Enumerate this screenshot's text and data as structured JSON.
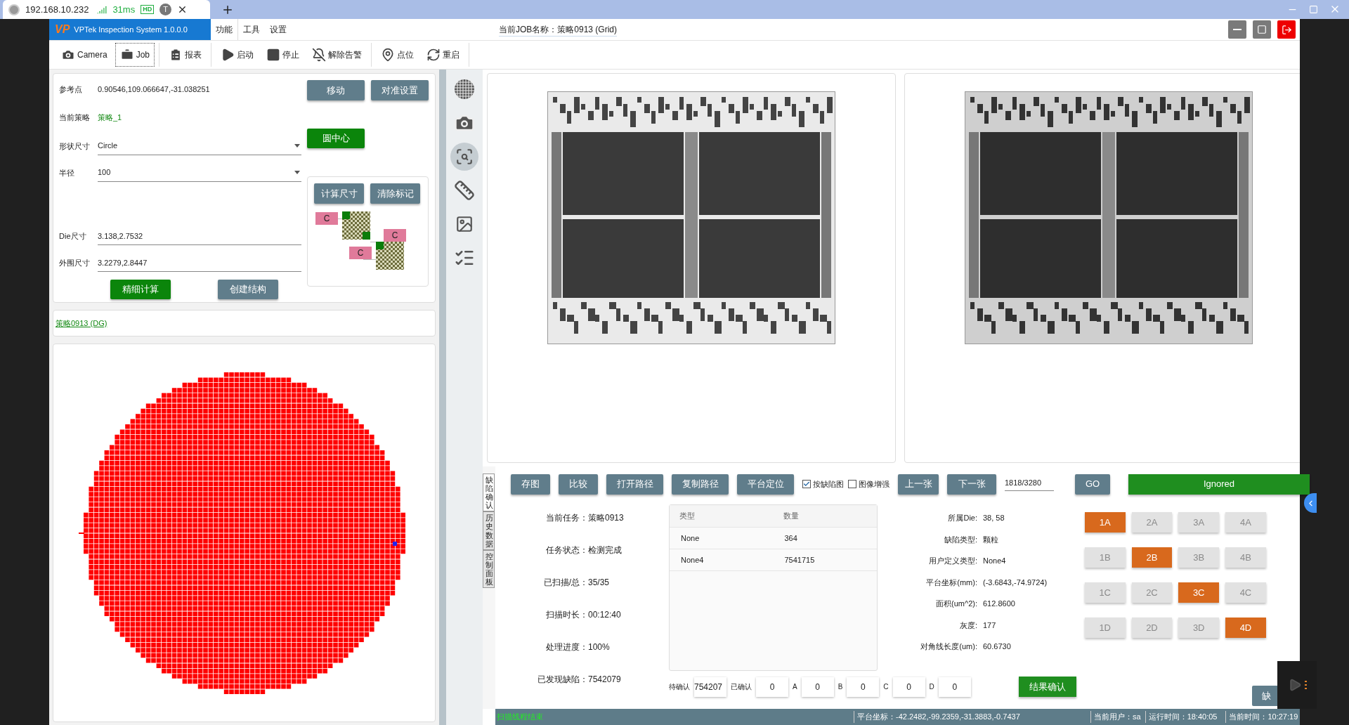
{
  "browser_tab": {
    "address": "192.168.10.232",
    "ping": "31ms",
    "badge": "HD",
    "avatar": "T"
  },
  "app": {
    "logo": "VP",
    "title": "VPTek Inspection System 1.0.0.0",
    "job_title": "当前JOB名称：策略0913 (Grid)"
  },
  "menu": [
    {
      "label": "功能",
      "selected": true
    },
    {
      "label": "工具",
      "selected": false
    },
    {
      "label": "设置",
      "selected": false
    }
  ],
  "toolbar": [
    {
      "label": "Camera",
      "kind": "camera",
      "selected": false
    },
    {
      "label": "Job",
      "kind": "job",
      "selected": true
    },
    {
      "label": "报表",
      "kind": "report",
      "selected": false
    },
    {
      "label": "启动",
      "kind": "start",
      "selected": false
    },
    {
      "label": "停止",
      "kind": "stop",
      "selected": false
    },
    {
      "label": "解除告警",
      "kind": "alarm",
      "selected": false
    },
    {
      "label": "点位",
      "kind": "point",
      "selected": false
    },
    {
      "label": "重启",
      "kind": "restart",
      "selected": false
    }
  ],
  "settings": {
    "ref_label": "参考点",
    "ref_value": "0.90546,109.066647,-31.038251",
    "strategy_label": "当前策略",
    "strategy_value": "策略_1",
    "fields": [
      {
        "label": "形状尺寸",
        "value": "Circle",
        "kind": "select"
      },
      {
        "label": "半径",
        "value": "100",
        "kind": "select"
      },
      {
        "label": "Die尺寸",
        "value": "3.138,2.7532",
        "kind": "input"
      },
      {
        "label": "外围尺寸",
        "value": "3.2279,2.8447",
        "kind": "input"
      }
    ],
    "top_buttons": [
      {
        "label": "移动",
        "kind": "slate"
      },
      {
        "label": "对准设置",
        "kind": "slate"
      }
    ],
    "center_button": {
      "label": "圆中心",
      "kind": "green"
    },
    "bottom_buttons": [
      {
        "label": "精细计算",
        "kind": "green"
      },
      {
        "label": "创建结构",
        "kind": "slate"
      }
    ],
    "structure_buttons": [
      {
        "label": "计算尺寸",
        "kind": "slate"
      },
      {
        "label": "清除标记",
        "kind": "slate"
      }
    ],
    "structure_tags": [
      "C",
      "C",
      "C"
    ]
  },
  "strategy_link": "策略0913 (DG)",
  "side_tools": [
    {
      "kind": "wafer",
      "selected": false
    },
    {
      "kind": "camera",
      "selected": false
    },
    {
      "kind": "map",
      "selected": true
    },
    {
      "kind": "tools",
      "selected": false
    },
    {
      "kind": "image",
      "selected": false
    },
    {
      "kind": "checklist",
      "selected": false
    }
  ],
  "bottom_tabs": [
    {
      "label": "缺陷确认",
      "selected": true
    },
    {
      "label": "历史数据",
      "selected": false
    },
    {
      "label": "控制面板",
      "selected": false
    }
  ],
  "actions": [
    {
      "label": "存图"
    },
    {
      "label": "比较"
    },
    {
      "label": "打开路径"
    },
    {
      "label": "复制路径"
    },
    {
      "label": "平台定位"
    }
  ],
  "checkboxes": [
    {
      "label": "按缺陷图",
      "checked": true
    },
    {
      "label": "图像增强",
      "checked": false
    }
  ],
  "nav": {
    "prev": "上一张",
    "next": "下一张",
    "page": "1818/3280",
    "go": "GO"
  },
  "result": "Ignored",
  "task_info": [
    {
      "label": "当前任务：",
      "value": "策略0913"
    },
    {
      "label": "任务状态：",
      "value": "检测完成"
    },
    {
      "label": "已扫描/总：",
      "value": "35/35"
    },
    {
      "label": "扫描时长：",
      "value": "00:12:40"
    },
    {
      "label": "处理进度：",
      "value": "100%"
    },
    {
      "label": "已发现缺陷：",
      "value": "7542079"
    }
  ],
  "defect_table": {
    "columns": [
      "类型",
      "数量"
    ],
    "rows": [
      [
        "None",
        "364"
      ],
      [
        "None4",
        "7541715"
      ]
    ]
  },
  "defect_info": [
    {
      "label": "所属Die:",
      "value": "38, 58"
    },
    {
      "label": "缺陷类型:",
      "value": "颗粒"
    },
    {
      "label": "用户定义类型:",
      "value": "None4"
    },
    {
      "label": "平台坐标(mm):",
      "value": "(-3.6843,-74.9724)"
    },
    {
      "label": "面积(um^2):",
      "value": "612.8600"
    },
    {
      "label": "灰度:",
      "value": "177"
    },
    {
      "label": "对角线长度(um):",
      "value": "60.6730"
    }
  ],
  "grades": [
    {
      "label": "1A",
      "selected": true
    },
    {
      "label": "2A",
      "selected": false
    },
    {
      "label": "3A",
      "selected": false
    },
    {
      "label": "4A",
      "selected": false
    },
    {
      "label": "1B",
      "selected": false
    },
    {
      "label": "2B",
      "selected": true
    },
    {
      "label": "3B",
      "selected": false
    },
    {
      "label": "4B",
      "selected": false
    },
    {
      "label": "1C",
      "selected": false
    },
    {
      "label": "2C",
      "selected": false
    },
    {
      "label": "3C",
      "selected": true
    },
    {
      "label": "4C",
      "selected": false
    },
    {
      "label": "1D",
      "selected": false
    },
    {
      "label": "2D",
      "selected": false
    },
    {
      "label": "3D",
      "selected": false
    },
    {
      "label": "4D",
      "selected": true
    }
  ],
  "counts": [
    {
      "label": "待确认",
      "value": "754207"
    },
    {
      "label": "已确认",
      "value": "0"
    },
    {
      "label": "A",
      "value": "0"
    },
    {
      "label": "B",
      "value": "0"
    },
    {
      "label": "C",
      "value": "0"
    },
    {
      "label": "D",
      "value": "0"
    }
  ],
  "confirm_button": "结果确认",
  "partial_button": "缺",
  "status_bar": {
    "message": "扫描线程结束",
    "coords": "平台坐标：-42.2482,-99.2359,-31.3883,-0.7437",
    "user": "当前用户：sa",
    "runtime": "运行时间：18:40:05",
    "time": "当前时间：10:27:19"
  }
}
